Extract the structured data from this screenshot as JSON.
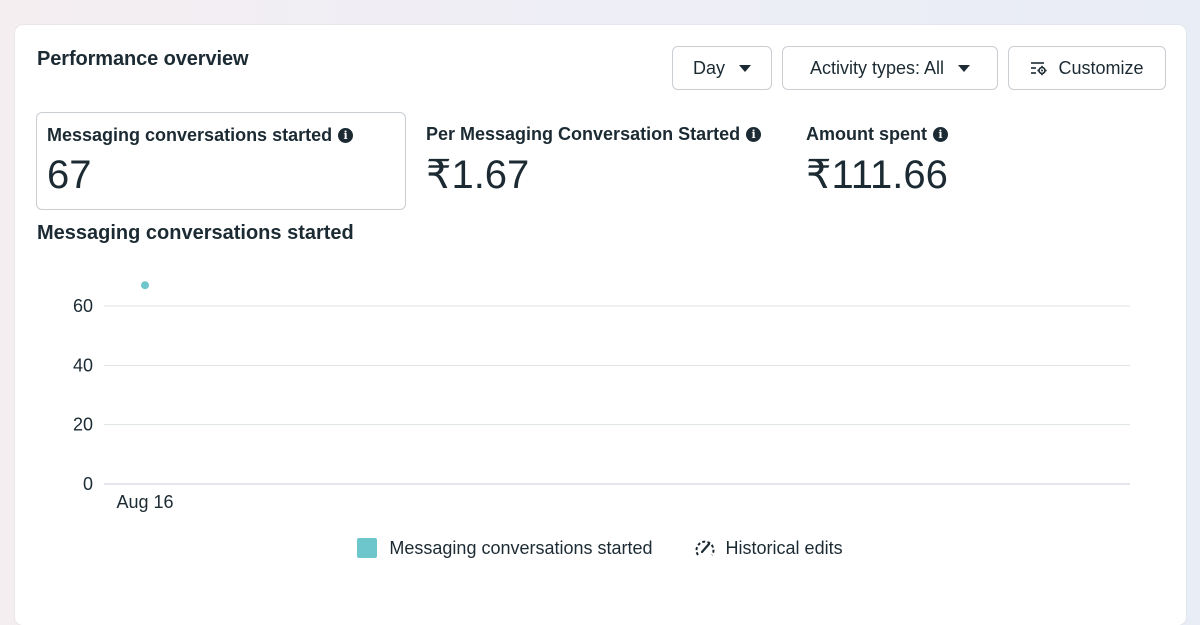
{
  "header": {
    "title": "Performance overview",
    "day_label": "Day",
    "activity_label": "Activity types: All",
    "customize_label": "Customize"
  },
  "metrics": [
    {
      "label": "Messaging conversations started",
      "value": "67",
      "selected": true
    },
    {
      "label": "Per Messaging Conversation Started",
      "value": "₹1.67",
      "selected": false
    },
    {
      "label": "Amount spent",
      "value": "₹111.66",
      "selected": false
    }
  ],
  "chart": {
    "title": "Messaging conversations started"
  },
  "chart_data": {
    "type": "scatter",
    "categories": [
      "Aug 16"
    ],
    "series": [
      {
        "name": "Messaging conversations started",
        "values": [
          67
        ],
        "color": "#6cc6cc"
      }
    ],
    "yticks": [
      0,
      20,
      40,
      60
    ],
    "ylim": [
      0,
      60
    ],
    "grid": true,
    "legend_position": "bottom-center"
  },
  "legend": {
    "series_label": "Messaging conversations started",
    "series_color": "#6cc6cc",
    "historical_label": "Historical edits",
    "historical_icon": "historical-edits-icon"
  },
  "colors": {
    "text": "#1c2b33",
    "border": "#c9ced3",
    "grid": "#dfe3e6"
  }
}
